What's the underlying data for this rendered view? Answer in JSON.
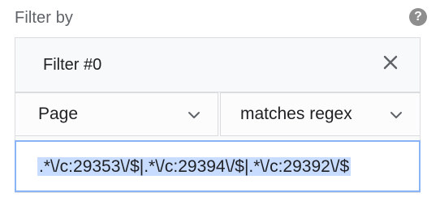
{
  "header": {
    "title": "Filter by",
    "help_icon": "?"
  },
  "filter": {
    "name": "Filter #0",
    "close_icon": "close-icon",
    "field_select": {
      "value": "Page"
    },
    "operator_select": {
      "value": "matches regex"
    },
    "regex_input": {
      "value": ".*\\/c:29353\\/$|.*\\/c:29394\\/$|.*\\/c:29392\\/$"
    }
  }
}
